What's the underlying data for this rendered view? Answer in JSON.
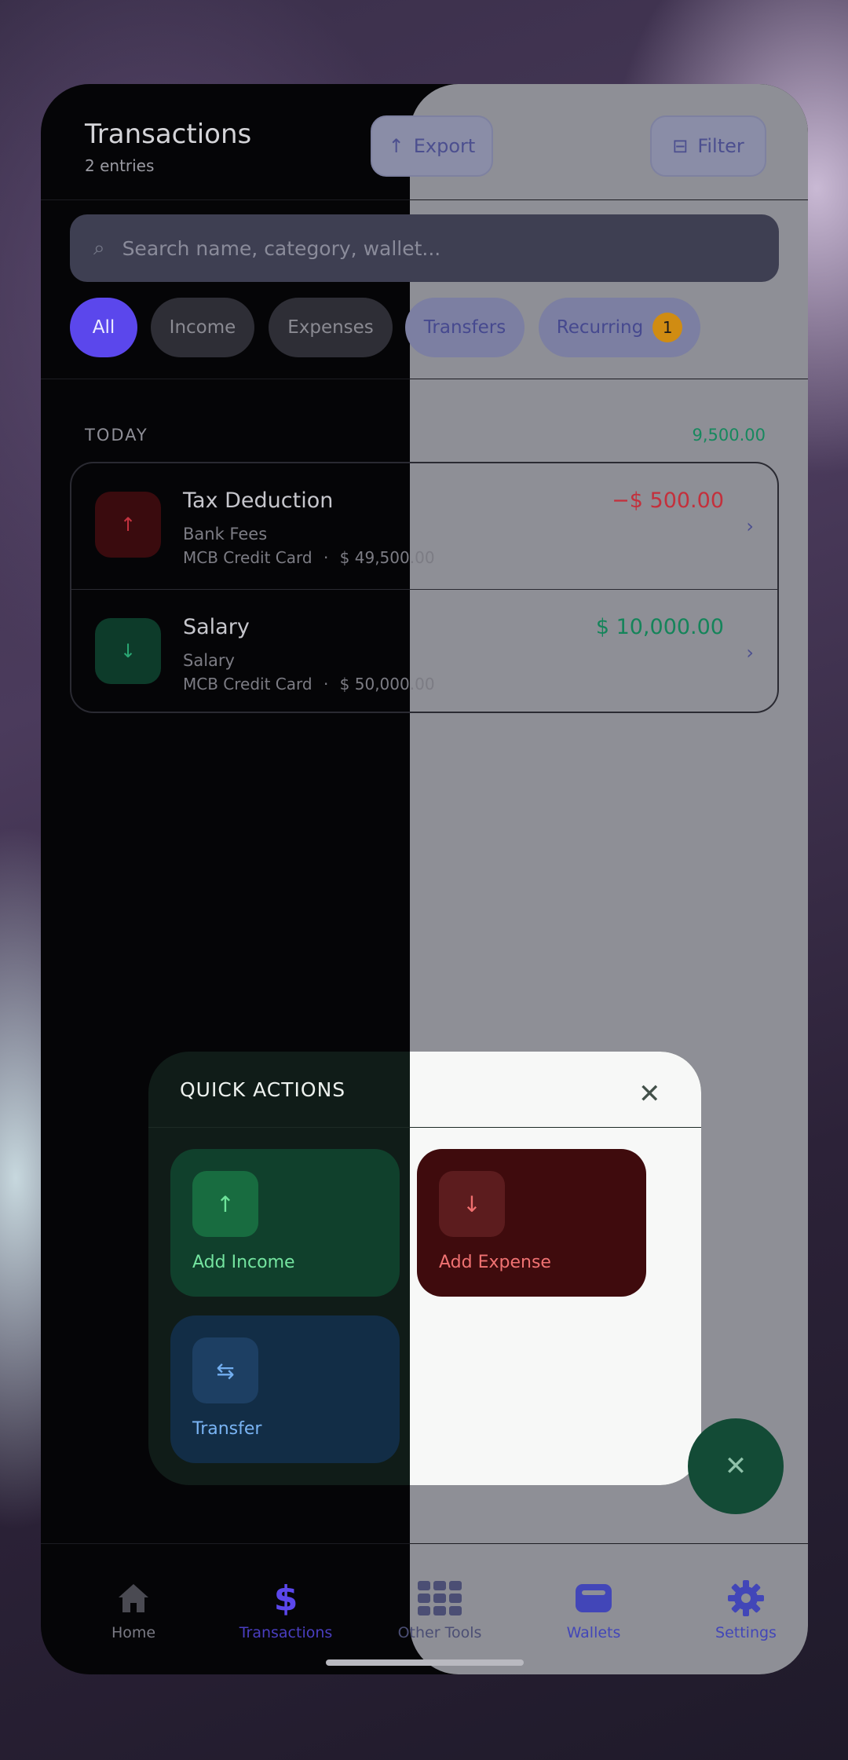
{
  "header": {
    "title": "Transactions",
    "subtitle": "2 entries",
    "export_label": "Export",
    "filter_label": "Filter"
  },
  "search": {
    "placeholder": "Search name, category, wallet..."
  },
  "filters": {
    "all": "All",
    "income": "Income",
    "expenses": "Expenses",
    "transfers": "Transfers",
    "recurring": "Recurring",
    "recurring_count": "1"
  },
  "section": {
    "label": "TODAY",
    "total": "9,500.00"
  },
  "transactions": [
    {
      "name": "Tax Deduction",
      "category": "Bank Fees",
      "wallet": "MCB Credit Card",
      "separator": "·",
      "balance": "$ 49,500.00",
      "amount": "−$ 500.00",
      "icon": "arrow-up-icon"
    },
    {
      "name": "Salary",
      "category": "Salary",
      "wallet": "MCB Credit Card",
      "separator": "·",
      "balance": "$ 50,000.00",
      "amount": "$ 10,000.00",
      "icon": "arrow-down-icon"
    }
  ],
  "quick_actions": {
    "title": "QUICK ACTIONS",
    "add_income": "Add Income",
    "add_expense": "Add Expense",
    "transfer": "Transfer"
  },
  "nav": {
    "home": "Home",
    "transactions": "Transactions",
    "other_tools": "Other Tools",
    "wallets": "Wallets",
    "settings": "Settings"
  },
  "colors": {
    "accent": "#5b47ec",
    "income": "#17885e",
    "expense": "#d0303c",
    "recurring_badge": "#d08c12"
  }
}
